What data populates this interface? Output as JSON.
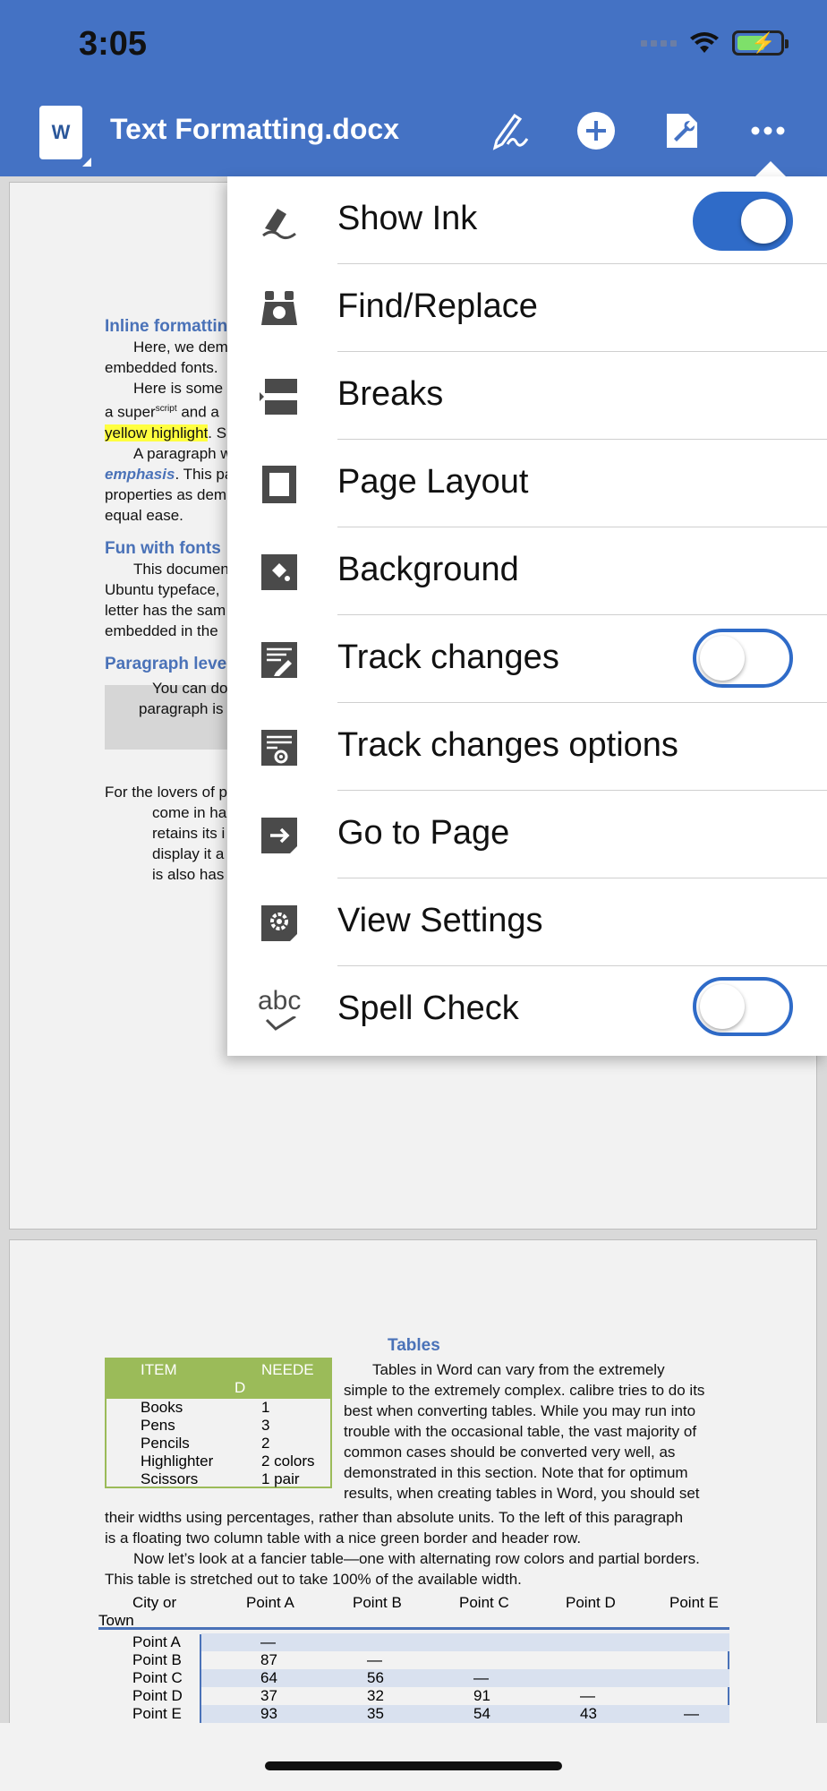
{
  "status_bar": {
    "time": "3:05"
  },
  "header": {
    "doc_icon_letter": "W",
    "title": "Text Formatting.docx"
  },
  "menu": {
    "items": [
      {
        "label": "Show Ink",
        "icon": "pen-ink-icon",
        "toggle": "on"
      },
      {
        "label": "Find/Replace",
        "icon": "binoculars-icon"
      },
      {
        "label": "Breaks",
        "icon": "breaks-icon"
      },
      {
        "label": "Page Layout",
        "icon": "page-layout-icon"
      },
      {
        "label": "Background",
        "icon": "paint-bucket-icon"
      },
      {
        "label": "Track changes",
        "icon": "track-changes-icon",
        "toggle": "off"
      },
      {
        "label": "Track changes options",
        "icon": "track-changes-options-icon"
      },
      {
        "label": "Go to Page",
        "icon": "go-to-page-icon"
      },
      {
        "label": "View Settings",
        "icon": "view-settings-icon"
      },
      {
        "label": "Spell Check",
        "icon": "spell-check-icon",
        "toggle": "off"
      }
    ],
    "spell_icon_text": "abc"
  },
  "doc": {
    "inline_heading": "Inline formatting",
    "p1a": "Here, we dem",
    "p1b": "embedded fonts.",
    "p2a": "Here is some",
    "p2b_pre": "a super",
    "p2b_sup": "script",
    "p2b_post": " and a",
    "p2c_hl": "yellow highlight",
    "p2c_post": ". S",
    "p3a": "A paragraph w",
    "p3b_em": "emphasis",
    "p3b_post": ". This pa",
    "p3c": "properties as dem",
    "p3d": "equal ease.",
    "fonts_heading": "Fun with fonts",
    "f1": "This documen",
    "f2": "Ubuntu typeface,",
    "f3": "letter has the sam",
    "f4": "embedded in the",
    "para_heading": "Paragraph level",
    "g1": "You can do",
    "g2": "paragraph is",
    "l1": "For the lovers of p",
    "l2": "come in ha",
    "l3": "retains its i",
    "l4": "display it a",
    "l5": "is also has",
    "tables_heading": "Tables",
    "t_para": [
      "Tables in Word can vary from the extremely",
      "simple to the extremely complex. calibre tries to do its",
      "best when converting tables. While you may run into",
      "trouble with the occasional table, the vast majority of",
      "common cases should be converted very well, as",
      "demonstrated in this section. Note that for optimum",
      "results, when creating tables in Word, you should set"
    ],
    "t_full": [
      "their widths using percentages, rather than absolute units.  To the left of this paragraph",
      "is a floating two column table with a nice green border and header row.",
      "Now let’s look at a fancier table—one with alternating row colors and partial borders.",
      "This table is stretched out to take 100% of the available width."
    ],
    "simple_table": {
      "head_item": "ITEM",
      "head_needed_1": "NEEDE",
      "head_needed_2": "D",
      "rows": [
        {
          "item": "Books",
          "qty": "1"
        },
        {
          "item": "Pens",
          "qty": "3"
        },
        {
          "item": "Pencils",
          "qty": "2"
        },
        {
          "item": "Highlighter",
          "qty": "2 colors"
        },
        {
          "item": "Scissors",
          "qty": "1 pair"
        }
      ]
    },
    "fancy_table": {
      "header": [
        "City or",
        "Point A",
        "Point B",
        "Point C",
        "Point D",
        "Point E"
      ],
      "header_wrap": "Town",
      "rows": [
        [
          "Point A",
          "—",
          "",
          "",
          "",
          ""
        ],
        [
          "Point B",
          "87",
          "—",
          "",
          "",
          ""
        ],
        [
          "Point C",
          "64",
          "56",
          "—",
          "",
          ""
        ],
        [
          "Point D",
          "37",
          "32",
          "91",
          "—",
          ""
        ],
        [
          "Point E",
          "93",
          "35",
          "54",
          "43",
          "—"
        ]
      ]
    }
  }
}
